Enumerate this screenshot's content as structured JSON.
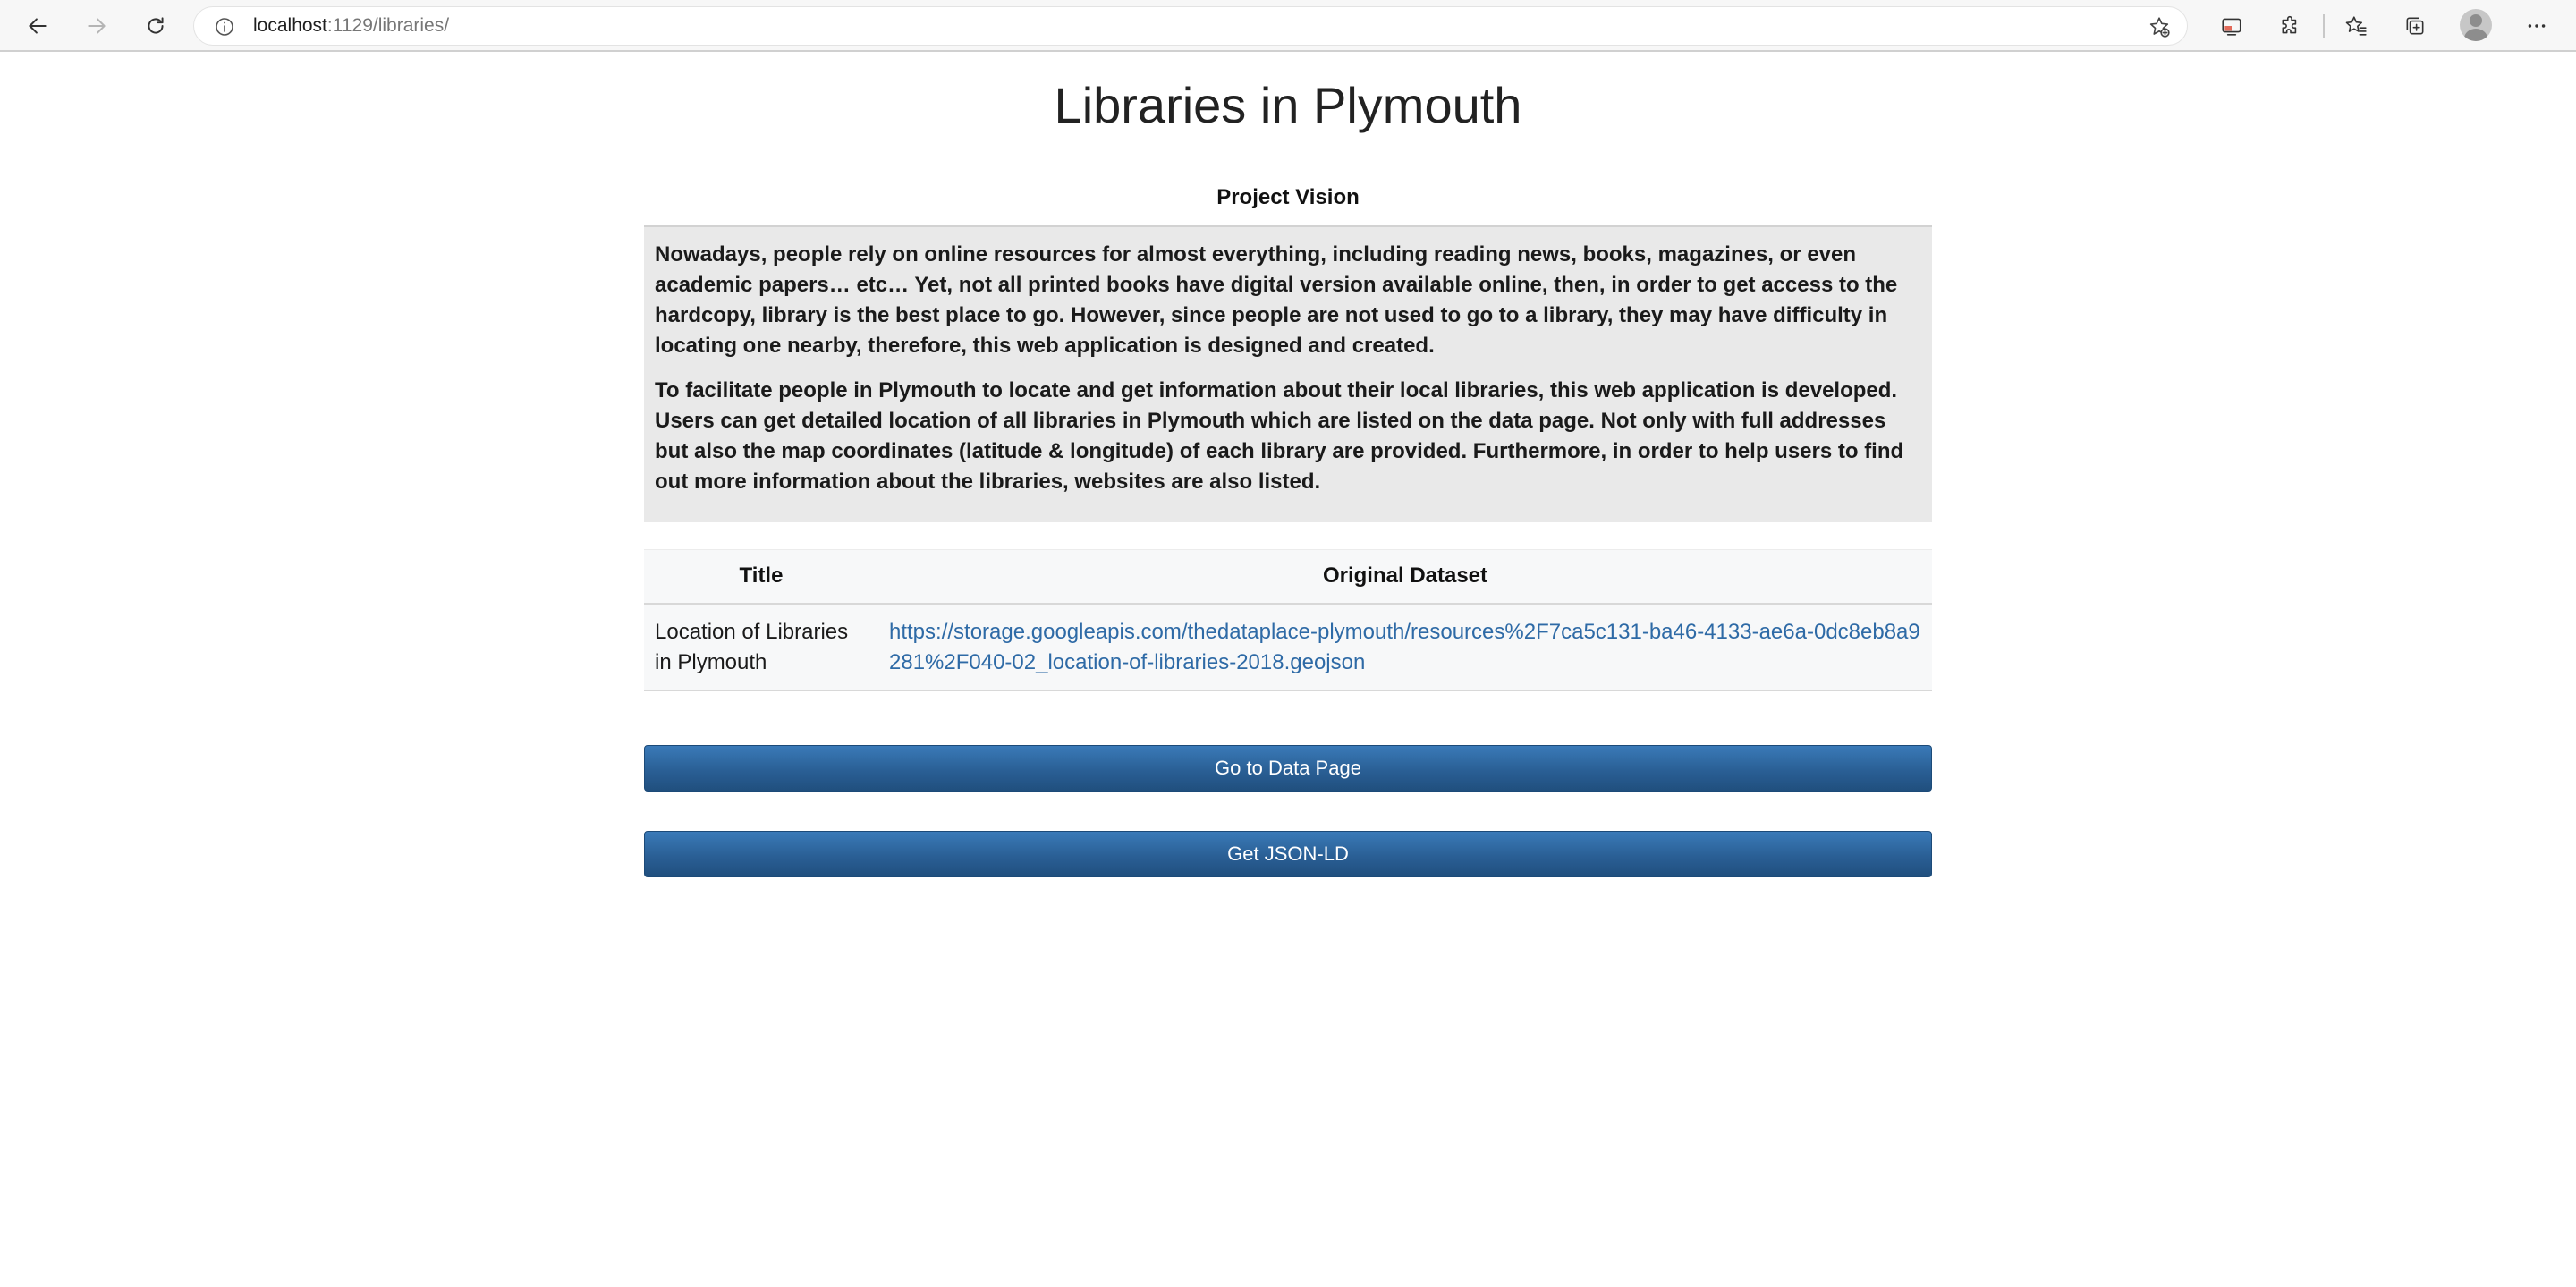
{
  "browser": {
    "url_host": "localhost",
    "url_port_path": ":1129/libraries/"
  },
  "page": {
    "title": "Libraries in Plymouth",
    "vision_heading": "Project Vision",
    "vision_paragraphs": [
      "Nowadays, people rely on online resources for almost everything, including reading news, books, magazines, or even academic papers… etc… Yet, not all printed books have digital version available online, then, in order to get access to the hardcopy, library is the best place to go. However, since people are not used to go to a library, they may have difficulty in locating one nearby, therefore, this web application is designed and created.",
      "To facilitate people in Plymouth to locate and get information about their local libraries, this web application is developed. Users can get detailed location of all libraries in Plymouth which are listed on the data page. Not only with full addresses but also the map coordinates (latitude & longitude) of each library are provided. Furthermore, in order to help users to find out more information about the libraries, websites are also listed."
    ]
  },
  "table": {
    "headers": [
      "Title",
      "Original Dataset"
    ],
    "rows": [
      {
        "title": "Location of Libraries in Plymouth",
        "dataset": "https://storage.googleapis.com/thedataplace-plymouth/resources%2F7ca5c131-ba46-4133-ae6a-0dc8eb8a9281%2F040-02_location-of-libraries-2018.geojson"
      }
    ]
  },
  "buttons": {
    "data_page": "Go to Data Page",
    "json_ld": "Get JSON-LD"
  },
  "colors": {
    "button": "#2a5f95",
    "link": "#2e6aa6",
    "vision_background": "#e9e9e9"
  },
  "icons": [
    "back-arrow-icon",
    "forward-arrow-icon",
    "refresh-icon",
    "info-icon",
    "favorite-add-icon",
    "screen-cast-icon",
    "extensions-icon",
    "favorites-icon",
    "collections-icon",
    "profile-avatar",
    "more-options-icon"
  ]
}
